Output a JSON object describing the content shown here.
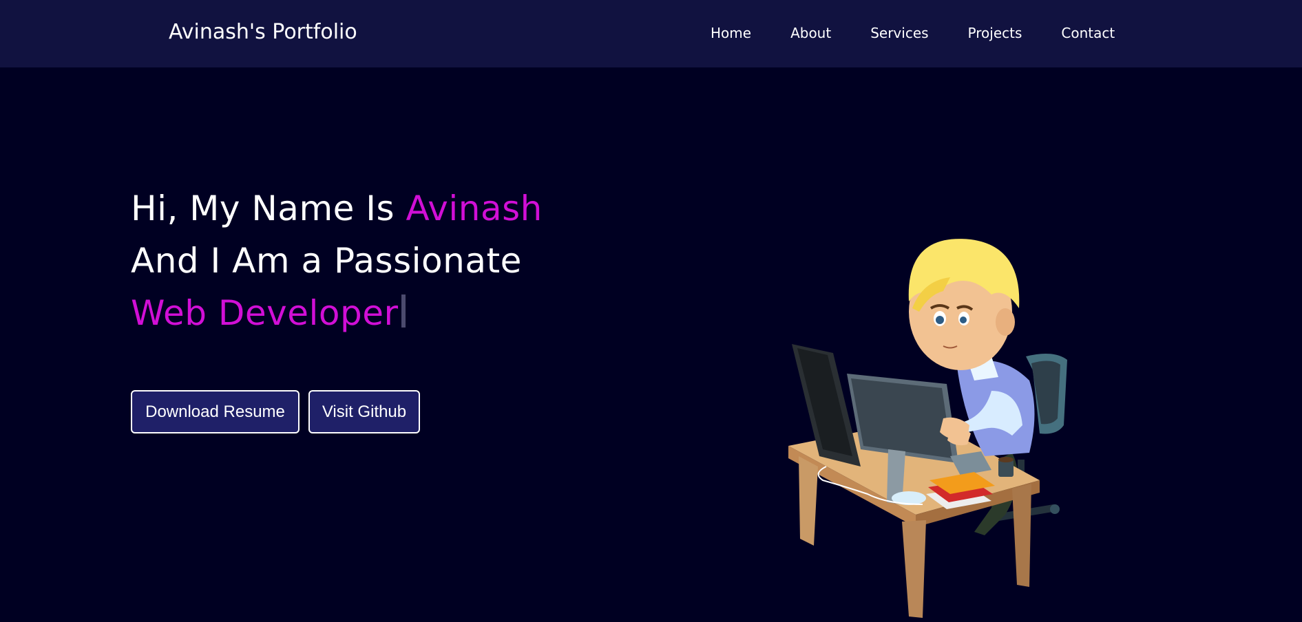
{
  "navbar": {
    "brand": "Avinash's Portfolio",
    "links": [
      "Home",
      "About",
      "Services",
      "Projects",
      "Contact"
    ]
  },
  "hero": {
    "line1_prefix": "Hi, My Name Is ",
    "line1_name": "Avinash",
    "line2": "And I Am a Passionate",
    "line3": "Web Developer"
  },
  "buttons": {
    "resume": "Download Resume",
    "github": "Visit Github"
  },
  "illustration": {
    "icon": "developer-at-desk-illustration"
  },
  "colors": {
    "navbar_bg": "#111240",
    "page_bg": "#000022",
    "accent": "#d10fd6",
    "button_bg": "#1f2068"
  }
}
